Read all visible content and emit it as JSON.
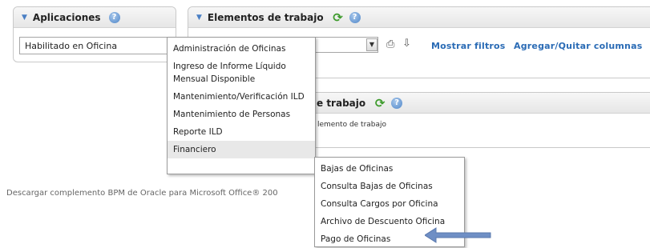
{
  "apps_panel": {
    "title": "Aplicaciones",
    "selected": "Habilitado en Oficina"
  },
  "work_panel": {
    "title": "Elementos de trabajo",
    "show_filters": "Mostrar filtros",
    "add_remove_columns": "Agregar/Quitar columnas"
  },
  "second_panel": {
    "title_fragment": "e trabajo",
    "body_fragment": "lemento de trabajo"
  },
  "app_menu": {
    "items": [
      "Administración de Oficinas",
      "Ingreso de Informe Líquido Mensual Disponible",
      "Mantenimiento/Verificación ILD",
      "Mantenimiento de Personas",
      "Reporte ILD",
      "Financiero"
    ]
  },
  "sub_menu": {
    "items": [
      "Bajas de Oficinas",
      "Consulta Bajas de Oficinas",
      "Consulta Cargos por Oficina",
      "Archivo de Descuento Oficina",
      "Pago de Oficinas"
    ]
  },
  "footer": {
    "text": "Descargar complemento BPM de Oracle para Microsoft Office® 200"
  },
  "colors": {
    "accent": "#2a6bb5",
    "arrow": "#6f8fc5"
  }
}
